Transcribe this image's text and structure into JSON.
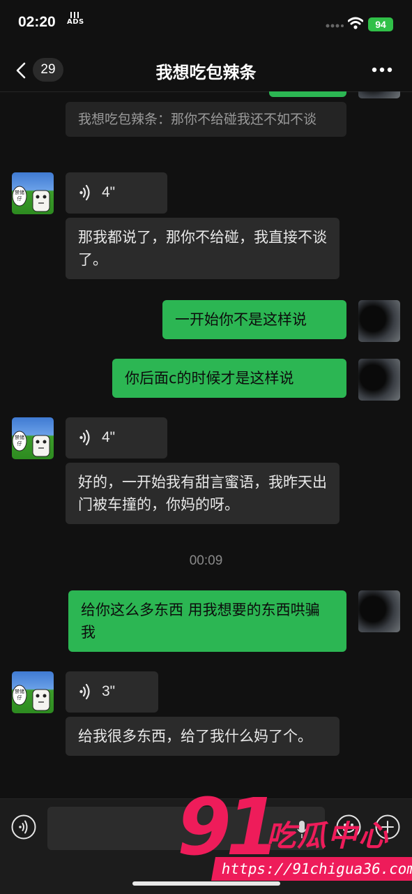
{
  "status_bar": {
    "time": "02:20",
    "ads_label": "ADS",
    "battery": "94"
  },
  "header": {
    "back_badge": "29",
    "title": "我想吃包辣条"
  },
  "messages": {
    "m0_quote": "我想吃包辣条：那你不给碰我还不如不谈",
    "m1_voice": "4\"",
    "m2_text": "那我都说了，那你不给碰，我直接不谈了。",
    "m3_text": "一开始你不是这样说",
    "m4_text": "你后面c的时候才是这样说",
    "m5_voice": "4\"",
    "m6_text": "好的，一开始我有甜言蜜语，我昨天出门被车撞的，你妈的呀。",
    "timestamp": "00:09",
    "m7_text": "给你这么多东西 用我想要的东西哄骗我",
    "m8_voice": "3\"",
    "m9_text": "给我很多东西，给了我什么妈了个。"
  },
  "avatar_text": "禁储仔",
  "input_bar": {
    "placeholder": ""
  },
  "watermark": {
    "number": "91",
    "name": "吃瓜中心",
    "url": "https://91chigua36.com"
  },
  "colors": {
    "background": "#111111",
    "incoming_bubble": "#2b2b2b",
    "outgoing_bubble": "#2cb653",
    "watermark": "#ee1c5a",
    "battery": "#30c048"
  }
}
